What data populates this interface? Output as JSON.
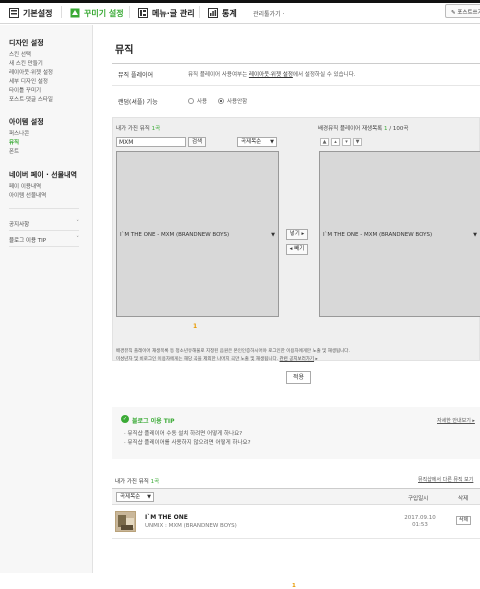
{
  "top_nav": {
    "items": [
      {
        "label": "기본설정",
        "icon": "settings-icon",
        "active": false
      },
      {
        "label": "꾸미기 설정",
        "icon": "paint-icon",
        "active": true
      },
      {
        "label": "메뉴·글 관리",
        "icon": "menu-manage-icon",
        "active": false
      },
      {
        "label": "통계",
        "icon": "stats-icon",
        "active": false
      }
    ],
    "admin_menu": "관리툴가기 ·",
    "post_button": "✎ 포스트쓰기"
  },
  "sidebar": {
    "design_title": "디자인 설정",
    "design_items": [
      "스킨 선택",
      "새 스킨 만들기",
      "레이아웃·위젯 설정",
      "세부 디자인 설정",
      "타이틀 꾸미기",
      "포스트·댓글 스타일"
    ],
    "item_title": "아이템 설정",
    "item_items": [
      "퍼스나콘",
      "뮤직",
      "폰트"
    ],
    "pay_title": "네이버 페이 · 선물내역",
    "pay_items": [
      "페이 이용내역",
      "아이템 선물내역"
    ],
    "notice": "공지사항",
    "blog_tip": "블로그 이용 TIP"
  },
  "page": {
    "title": "뮤직",
    "player_label": "뮤직 플레이어",
    "player_desc_pre": "뮤직 플레이어 사용여부는 ",
    "player_desc_link": "레이아웃·위젯 설정",
    "player_desc_post": "에서 설정하실 수 있습니다.",
    "random_label": "랜덤(셔플) 기능",
    "random_use": "사용",
    "random_nouse": "사용안함"
  },
  "panel": {
    "my_music_label": "내가 가진 뮤직",
    "my_music_count": "1곡",
    "search_value": "MXM",
    "search_button": "검색",
    "sort_select": "곡제목순",
    "my_list_item": "I`M THE ONE - MXM (BRANDNEW BOYS)",
    "playlist_label": "배경뮤직 플레이어 재생목록",
    "playlist_count": "1",
    "playlist_max": "/ 100곡",
    "playlist_item": "I`M THE ONE - MXM (BRANDNEW BOYS)",
    "add_button": "넣기 ▸",
    "remove_button": "◂ 빼기",
    "page_number": "1",
    "order_buttons": [
      "▲",
      "▴",
      "▾",
      "▼"
    ]
  },
  "notes": {
    "line1": "배경뮤직 플레이어 재생목록 등 청소년유해물로 지정된 음원은 본인인증하시어야 로그인한 이용자에게만 노출 및 재생됩니다.",
    "line2_pre": "미성년자 및 비로그인 이용자에게는 해당 곡을 제외한 나머지 곡만 노출 및 재생됩니다.",
    "line2_link": "관련 공지보러가기",
    "apply_button": "적용"
  },
  "tip": {
    "title": "블로그 이용 TIP",
    "more": "자세한 안내보기 ▸",
    "items": [
      "뮤직샵 플레이어 수동 설치 하려면 어떻게 하나요?",
      "뮤직샵 플레이어를 사용하지 않으려면 어떻게 하나요?"
    ]
  },
  "table": {
    "title": "내가 가진 뮤직",
    "count": "1곡",
    "shop_link": "뮤직샵에서 다른 뮤직 보기",
    "sort_select": "곡제목순",
    "col_date": "구입일시",
    "col_delete": "삭제",
    "rows": [
      {
        "title": "I`M THE ONE",
        "artist": "UNMIX : MXM (BRANDNEW BOYS)",
        "date": "2017.09.10 01:53",
        "delete": "삭제"
      }
    ]
  },
  "bottom_page": "1",
  "colors": {
    "accent": "#3aaa35",
    "page_num": "#e89a00"
  }
}
